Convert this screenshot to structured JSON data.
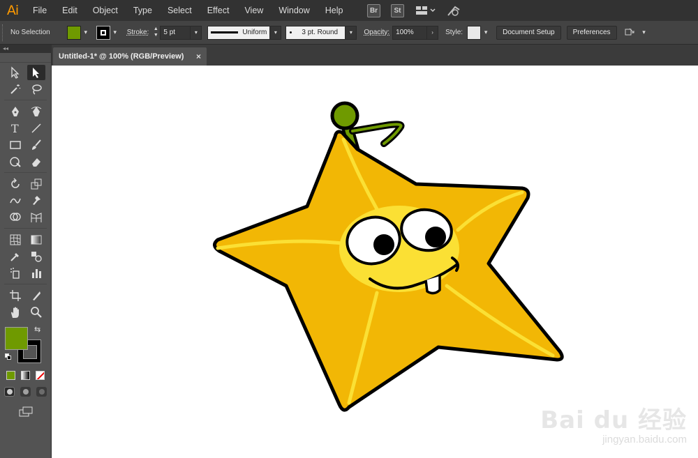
{
  "app": {
    "logo": "Ai",
    "brand_color": "#ff9a00"
  },
  "menu": [
    "File",
    "Edit",
    "Object",
    "Type",
    "Select",
    "Effect",
    "View",
    "Window",
    "Help"
  ],
  "menubar_icons": {
    "bridge": "Br",
    "stock": "St",
    "arrange": "arrange-documents-icon",
    "gpu": "gpu-performance-icon"
  },
  "control": {
    "selection": "No Selection",
    "fill_color": "#6f9a00",
    "stroke_label": "Stroke:",
    "stroke_weight": "5 pt",
    "profile": "Uniform",
    "brush": "3 pt. Round",
    "opacity_label": "Opacity:",
    "opacity": "100%",
    "style_label": "Style:",
    "document_setup": "Document Setup",
    "preferences": "Preferences"
  },
  "document": {
    "tab_title": "Untitled-1* @ 100% (RGB/Preview)",
    "close": "×"
  },
  "tools": {
    "fill_color": "#6f9a00",
    "stroke_color": "#000000"
  },
  "artwork": {
    "star_color": "#f2b705",
    "highlight_color": "#fbe034",
    "stem_color": "#6f9a00"
  },
  "watermark": {
    "main": "Bai du 经验",
    "sub": "jingyan.baidu.com"
  }
}
